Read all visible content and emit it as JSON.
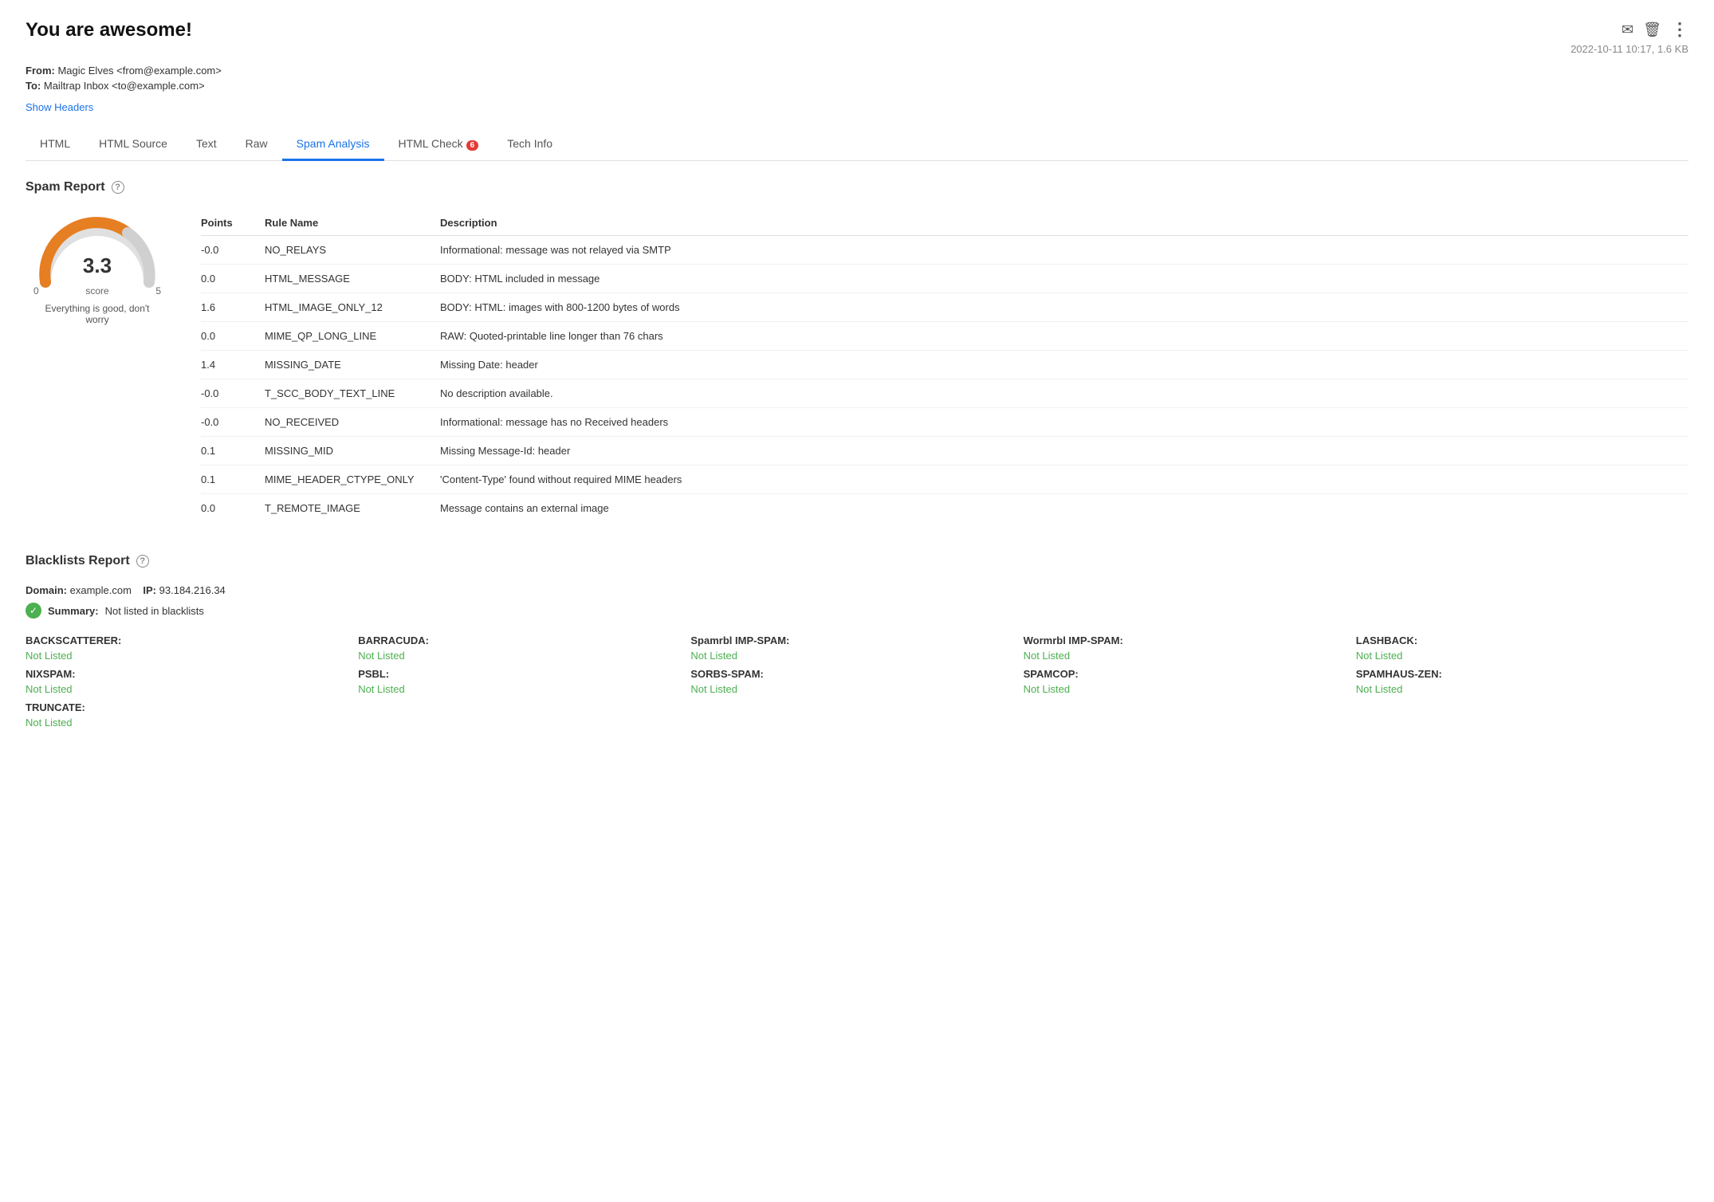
{
  "header": {
    "title": "You are awesome!",
    "from_label": "From:",
    "from_value": "Magic Elves <from@example.com>",
    "to_label": "To:",
    "to_value": "Mailtrap Inbox <to@example.com>",
    "date": "2022-10-11 10:17, 1.6 KB",
    "show_headers": "Show Headers"
  },
  "tabs": [
    {
      "label": "HTML",
      "active": false,
      "badge": null
    },
    {
      "label": "HTML Source",
      "active": false,
      "badge": null
    },
    {
      "label": "Text",
      "active": false,
      "badge": null
    },
    {
      "label": "Raw",
      "active": false,
      "badge": null
    },
    {
      "label": "Spam Analysis",
      "active": true,
      "badge": null
    },
    {
      "label": "HTML Check",
      "active": false,
      "badge": "6"
    },
    {
      "label": "Tech Info",
      "active": false,
      "badge": null
    }
  ],
  "spam_report": {
    "title": "Spam Report",
    "gauge": {
      "score": "3.3",
      "score_label": "score",
      "min": "0",
      "max": "5",
      "message": "Everything is good, don't worry"
    },
    "table_headers": {
      "points": "Points",
      "rule_name": "Rule Name",
      "description": "Description"
    },
    "rows": [
      {
        "points": "-0.0",
        "rule": "NO_RELAYS",
        "description": "Informational: message was not relayed via SMTP",
        "highlight": false
      },
      {
        "points": "0.0",
        "rule": "HTML_MESSAGE",
        "description": "BODY: HTML included in message",
        "highlight": false
      },
      {
        "points": "1.6",
        "rule": "HTML_IMAGE_ONLY_12",
        "description": "BODY: HTML: images with 800-1200 bytes of words",
        "highlight": true
      },
      {
        "points": "0.0",
        "rule": "MIME_QP_LONG_LINE",
        "description": "RAW: Quoted-printable line longer than 76 chars",
        "highlight": false
      },
      {
        "points": "1.4",
        "rule": "MISSING_DATE",
        "description": "Missing Date: header",
        "highlight": true
      },
      {
        "points": "-0.0",
        "rule": "T_SCC_BODY_TEXT_LINE",
        "description": "No description available.",
        "highlight": false
      },
      {
        "points": "-0.0",
        "rule": "NO_RECEIVED",
        "description": "Informational: message has no Received headers",
        "highlight": false
      },
      {
        "points": "0.1",
        "rule": "MISSING_MID",
        "description": "Missing Message-Id: header",
        "highlight": true
      },
      {
        "points": "0.1",
        "rule": "MIME_HEADER_CTYPE_ONLY",
        "description": "'Content-Type' found without required MIME headers",
        "highlight": true
      },
      {
        "points": "0.0",
        "rule": "T_REMOTE_IMAGE",
        "description": "Message contains an external image",
        "highlight": false
      }
    ]
  },
  "blacklists": {
    "title": "Blacklists Report",
    "domain_label": "Domain:",
    "domain_value": "example.com",
    "ip_label": "IP:",
    "ip_value": "93.184.216.34",
    "summary_label": "Summary:",
    "summary_value": "Not listed in blacklists",
    "items": [
      {
        "label": "BACKSCATTERER:",
        "value": "Not Listed"
      },
      {
        "label": "BARRACUDA:",
        "value": "Not Listed"
      },
      {
        "label": "Spamrbl IMP-SPAM:",
        "value": "Not Listed"
      },
      {
        "label": "Wormrbl IMP-SPAM:",
        "value": "Not Listed"
      },
      {
        "label": "LASHBACK:",
        "value": "Not Listed"
      },
      {
        "label": "NIXSPAM:",
        "value": "Not Listed"
      },
      {
        "label": "PSBL:",
        "value": "Not Listed"
      },
      {
        "label": "SORBS-SPAM:",
        "value": "Not Listed"
      },
      {
        "label": "SPAMCOP:",
        "value": "Not Listed"
      },
      {
        "label": "SPAMHAUS-ZEN:",
        "value": "Not Listed"
      },
      {
        "label": "TRUNCATE:",
        "value": "Not Listed"
      }
    ]
  },
  "icons": {
    "email": "✉",
    "trash": "🗑",
    "more": "⋮",
    "check": "✓",
    "question": "?"
  }
}
